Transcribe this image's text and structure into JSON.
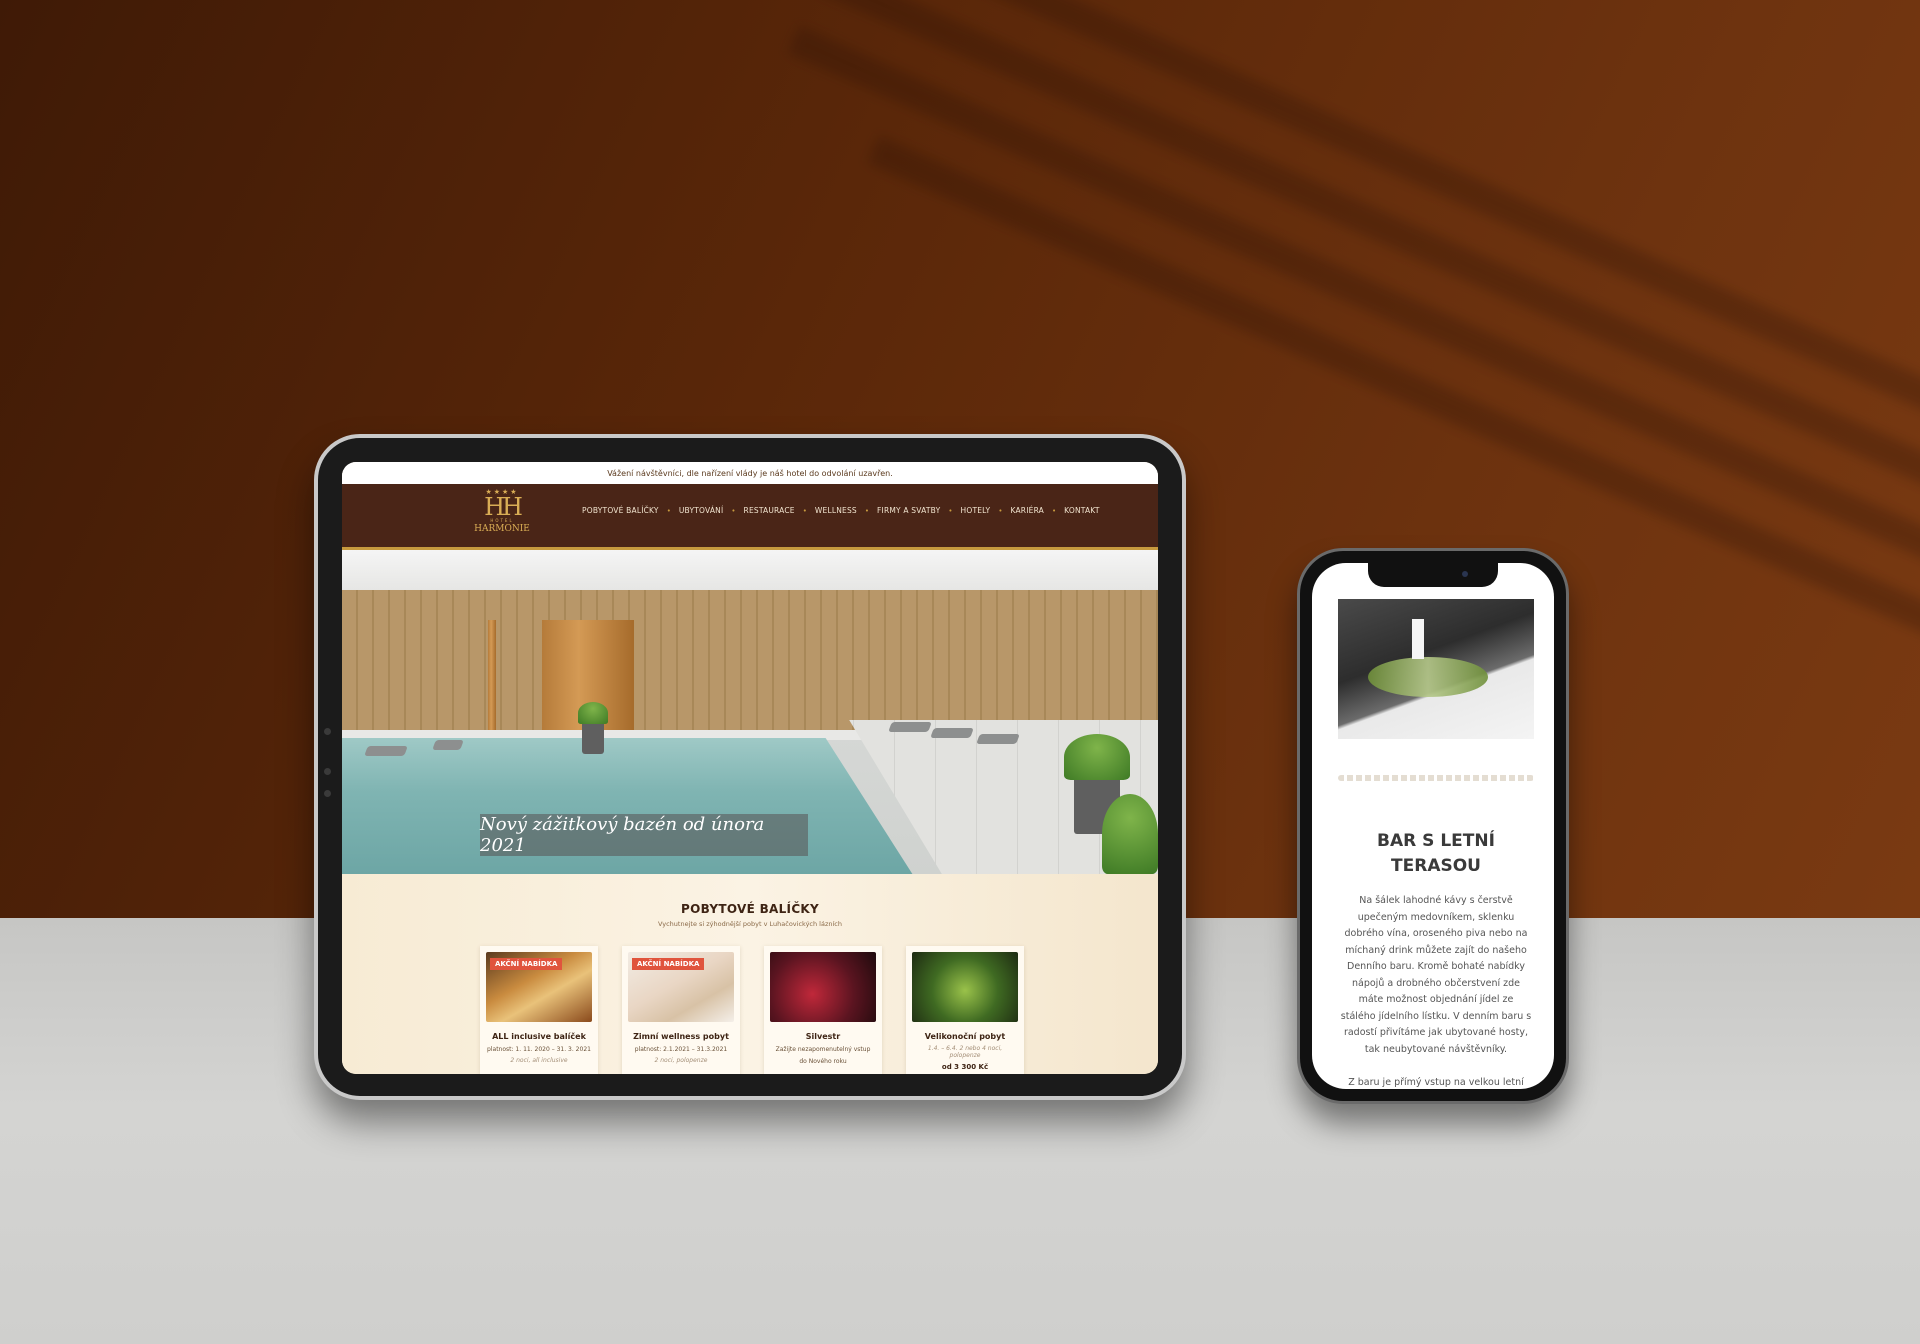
{
  "tablet_site": {
    "notice": "Vážení návštěvníci, dle nařízení vlády je náš hotel do odvolání uzavřen.",
    "logo": {
      "stars": "★★★★",
      "mark": "HH",
      "sub": "HOTEL",
      "name": "HARMONIE"
    },
    "nav": [
      {
        "label": "POBYTOVÉ BALÍČKY"
      },
      {
        "label": "UBYTOVÁNÍ"
      },
      {
        "label": "RESTAURACE"
      },
      {
        "label": "WELLNESS"
      },
      {
        "label": "FIRMY A SVATBY"
      },
      {
        "label": "HOTELY"
      },
      {
        "label": "KARIÉRA"
      },
      {
        "label": "KONTAKT"
      }
    ],
    "nav_separator": "•",
    "hero_caption": "Nový zážitkový bazén od února 2021",
    "packages": {
      "title": "POBYTOVÉ BALÍČKY",
      "subtitle": "Vychutnejte si zýhodnější pobyt v Luhačovických lázních",
      "cards": [
        {
          "badge": "AKČNÍ NABÍDKA",
          "title": "ALL inclusive balíček",
          "meta": "platnost: 1. 11. 2020 – 31. 3. 2021",
          "note": "2 noci, all inclusive",
          "price": ""
        },
        {
          "badge": "AKČNÍ NABÍDKA",
          "title": "Zimní wellness pobyt",
          "meta": "platnost: 2.1.2021 – 31.3.2021",
          "note": "2 noci, polopenze",
          "price": ""
        },
        {
          "badge": "",
          "title": "Silvestr",
          "meta": "Zažijte nezapomenutelný vstup",
          "note": "do Nového roku",
          "price": ""
        },
        {
          "badge": "",
          "title": "Velikonoční pobyt",
          "meta": "1.4. – 6.4.  2 nebo 4 noci, polopenze",
          "note": "",
          "price": "od 3 300 Kč"
        }
      ]
    }
  },
  "phone_site": {
    "heading": "BAR S LETNÍ TERASOU",
    "paragraph": "Na šálek lahodné kávy s čerstvě upečeným medovníkem, sklenku dobrého vína, oroseného piva nebo na míchaný drink můžete zajít do našeho Denního baru. Kromě bohaté nabídky nápojů a drobného občerstvení zde máte možnost objednání jídel ze stálého jídelního lístku. V denním baru s radostí přivítáme jak ubytované hosty, tak neubytované návštěvníky.",
    "paragraph2": "Z baru je přímý vstup na velkou letní terasu, odkud si při příjemném"
  },
  "colors": {
    "header_brown": "#4a2517",
    "gold": "#c79a3e",
    "badge_red": "#e0543d",
    "wall_brown": "#5a2709"
  }
}
